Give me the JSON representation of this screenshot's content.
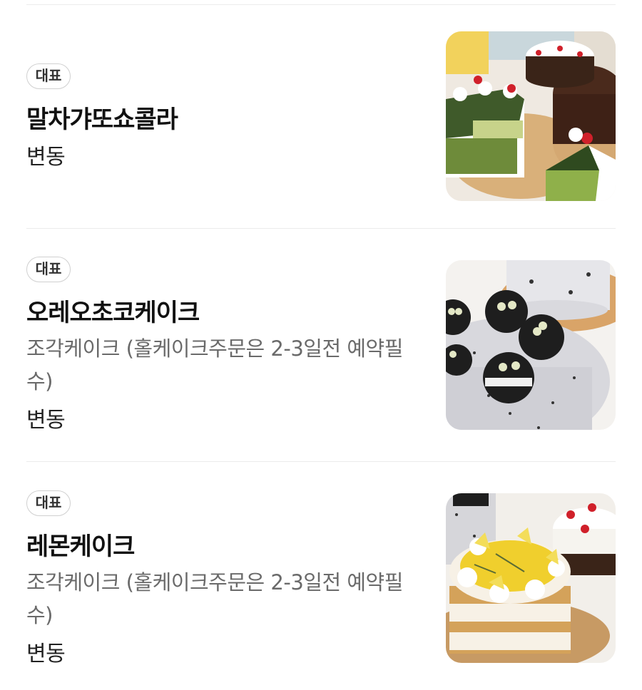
{
  "menu": {
    "items": [
      {
        "badge": "대표",
        "name": "말차갸또쇼콜라",
        "description": "",
        "price": "변동",
        "image": "matcha-gateau-chocolat-photo"
      },
      {
        "badge": "대표",
        "name": "오레오초코케이크",
        "description": "조각케이크 (홀케이크주문은 2-3일전 예약필수)",
        "price": "변동",
        "image": "oreo-choco-cake-photo"
      },
      {
        "badge": "대표",
        "name": "레몬케이크",
        "description": "조각케이크 (홀케이크주문은 2-3일전 예약필수)",
        "price": "변동",
        "image": "lemon-cake-photo"
      }
    ]
  },
  "colors": {
    "badge_border": "#d0d0d0",
    "divider": "#ececec",
    "description_text": "#6a6a6a"
  }
}
